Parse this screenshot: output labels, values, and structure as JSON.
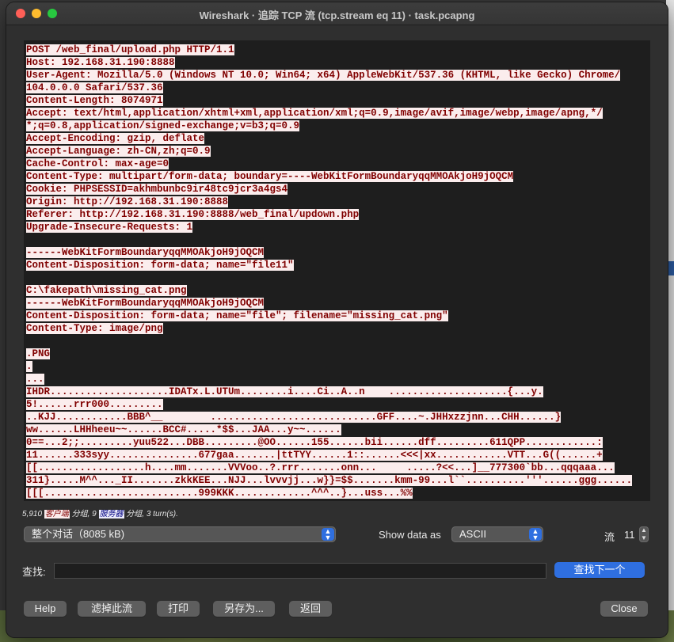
{
  "window": {
    "title": "Wireshark · 追踪 TCP 流 (tcp.stream eq 11) · task.pcapng"
  },
  "stream_lines": [
    "POST /web_final/upload.php HTTP/1.1",
    "Host: 192.168.31.190:8888",
    "User-Agent: Mozilla/5.0 (Windows NT 10.0; Win64; x64) AppleWebKit/537.36 (KHTML, like Gecko) Chrome/",
    "104.0.0.0 Safari/537.36",
    "Content-Length: 8074971",
    "Accept: text/html,application/xhtml+xml,application/xml;q=0.9,image/avif,image/webp,image/apng,*/",
    "*;q=0.8,application/signed-exchange;v=b3;q=0.9",
    "Accept-Encoding: gzip, deflate",
    "Accept-Language: zh-CN,zh;q=0.9",
    "Cache-Control: max-age=0",
    "Content-Type: multipart/form-data; boundary=----WebKitFormBoundaryqqMMOAkjoH9jOQCM",
    "Cookie: PHPSESSID=akhmbunbc9ir48tc9jcr3a4gs4",
    "Origin: http://192.168.31.190:8888",
    "Referer: http://192.168.31.190:8888/web_final/updown.php",
    "Upgrade-Insecure-Requests: 1",
    "",
    "------WebKitFormBoundaryqqMMOAkjoH9jOQCM",
    "Content-Disposition: form-data; name=\"file11\"",
    "",
    "C:\\fakepath\\missing_cat.png",
    "------WebKitFormBoundaryqqMMOAkjoH9jOQCM",
    "Content-Disposition: form-data; name=\"file\"; filename=\"missing_cat.png\"",
    "Content-Type: image/png",
    "",
    ".PNG",
    ".",
    "...",
    "IHDR....................IDATx.L.UTUm........i....Ci..A..n    ....................{...y.",
    "5!......rrr000.........",
    "..KJJ............BBB^__        ............................GFF....~.JHHxzzjnn...CHH......}",
    "ww......LHHheeu~~......BCC#.....*$$...JAA...y~~......",
    "0==...2;;.........yuu522...DBB.........@OO......155......bii......dff.........611QPP............:",
    "11......333syy...............677gaa.......|ttTYY......1::......<<<|xx............VTT...G((......+",
    "[[..................h....mm.......VVVoo..?.rrr.......onn...     .....?<<...]__777300`bb...qqqaaa...",
    "311}.....M^^..._II.......zkkKEE...NJJ...lvvvjj...w}}=$$.......kmm-99...l``..........'''......ggg......",
    "[[[..........................999KKK.............^^^..}...uss...%%"
  ],
  "summary": {
    "client_packets": "5,910",
    "client_label": "客户端",
    "packets_word1": "分组,",
    "server_packets": "9",
    "server_label": "服务器",
    "packets_word2": "分组,",
    "turns": "3 turn(s)."
  },
  "conversation_select": {
    "value": "整个对话（8085 kB)"
  },
  "show_data_as": {
    "label": "Show data as",
    "value": "ASCII"
  },
  "stream_number": {
    "label": "流",
    "value": "11"
  },
  "find": {
    "label": "查找:",
    "value": "",
    "next_label": "查找下一个"
  },
  "buttons": {
    "help": "Help",
    "filter_out": "滤掉此流",
    "print": "打印",
    "save_as": "另存为...",
    "back": "返回",
    "close": "Close"
  }
}
